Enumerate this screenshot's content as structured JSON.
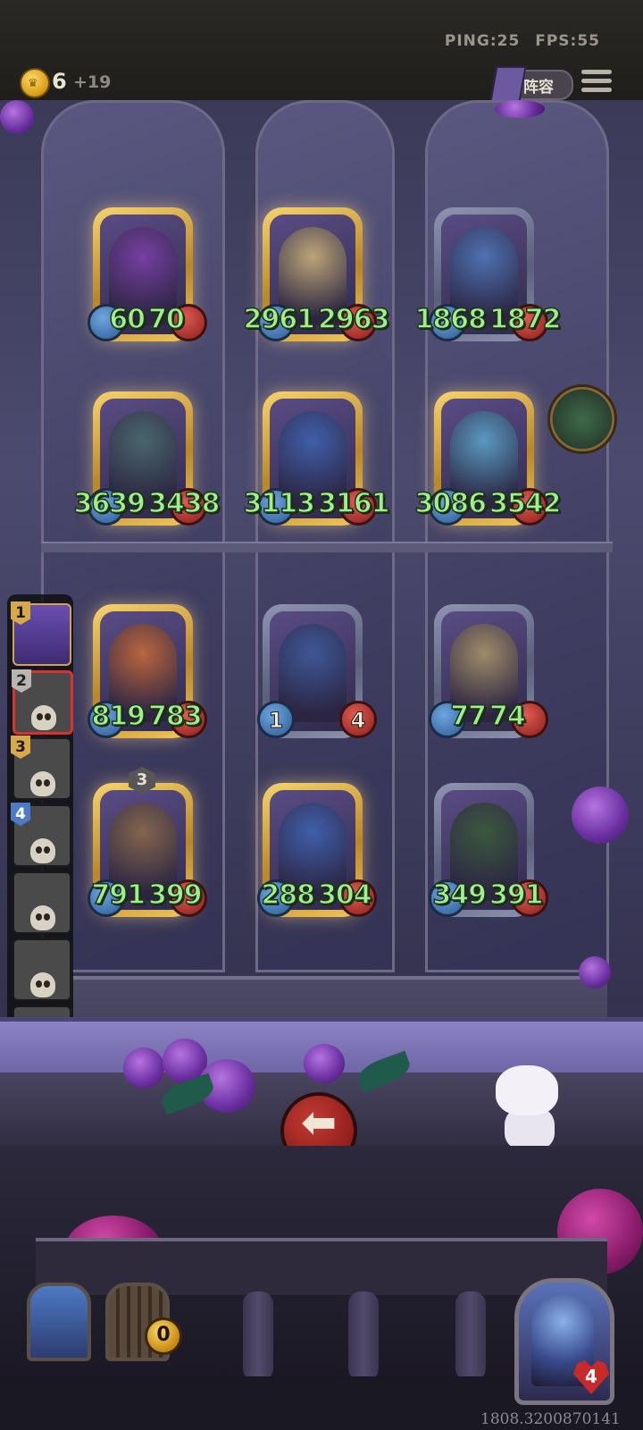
{
  "header": {
    "ping_label": "PING:25",
    "fps_label": "FPS:55",
    "gold": "6",
    "gold_income": "+19",
    "lineup_label": "阵容"
  },
  "board": {
    "rows": [
      [
        {
          "attack": "60",
          "health": "70",
          "frame": "gold",
          "portrait_color": "#7b3fa6"
        },
        {
          "attack": "2961",
          "health": "2963",
          "frame": "gold",
          "portrait_color": "#c9b07a"
        },
        {
          "attack": "1868",
          "health": "1872",
          "frame": "silver",
          "portrait_color": "#4f77b8"
        }
      ],
      [
        {
          "attack": "3639",
          "health": "3438",
          "frame": "gold",
          "portrait_color": "#4a6a6a"
        },
        {
          "attack": "3113",
          "health": "3161",
          "frame": "gold",
          "portrait_color": "#3f62b0"
        },
        {
          "attack": "3086",
          "health": "3542",
          "frame": "gold",
          "portrait_color": "#5ca3c8"
        }
      ],
      [
        {
          "attack": "819",
          "health": "783",
          "frame": "gold",
          "portrait_color": "#c76a3a"
        },
        {
          "attack": "1",
          "health": "4",
          "frame": "silver",
          "portrait_color": "#3d5a9a",
          "stats_inside": true
        },
        {
          "attack": "77",
          "health": "74",
          "frame": "silver",
          "portrait_color": "#a89468"
        }
      ],
      [
        {
          "attack": "791",
          "health": "399",
          "frame": "gold",
          "portrait_color": "#8a6a4a",
          "level": "3"
        },
        {
          "attack": "288",
          "health": "304",
          "frame": "gold",
          "portrait_color": "#3f62b0"
        },
        {
          "attack": "349",
          "health": "391",
          "frame": "silver",
          "portrait_color": "#3a5a3a"
        }
      ]
    ]
  },
  "roster": [
    {
      "rank": "1",
      "status": "alive",
      "rank_style": "gold"
    },
    {
      "rank": "2",
      "status": "dead",
      "rank_style": "silver",
      "selected": true
    },
    {
      "rank": "3",
      "status": "dead",
      "rank_style": "gold"
    },
    {
      "rank": "4",
      "status": "dead",
      "rank_style": "blue"
    },
    {
      "rank": "",
      "status": "dead"
    },
    {
      "rank": "",
      "status": "dead"
    },
    {
      "rank": "",
      "status": "dead"
    },
    {
      "rank": "",
      "status": "dead"
    }
  ],
  "back_button": {
    "label": "返回",
    "icon": "arrow-left-icon"
  },
  "bench": {
    "coin_count": "0"
  },
  "hero": {
    "lives": "4"
  },
  "footer": {
    "coords": "1808.3200870141"
  },
  "colors": {
    "stat_text": "#9ef08a",
    "attack_badge": "#2b5a94",
    "health_badge": "#8b1e1c",
    "back_button": "#c43a34"
  }
}
